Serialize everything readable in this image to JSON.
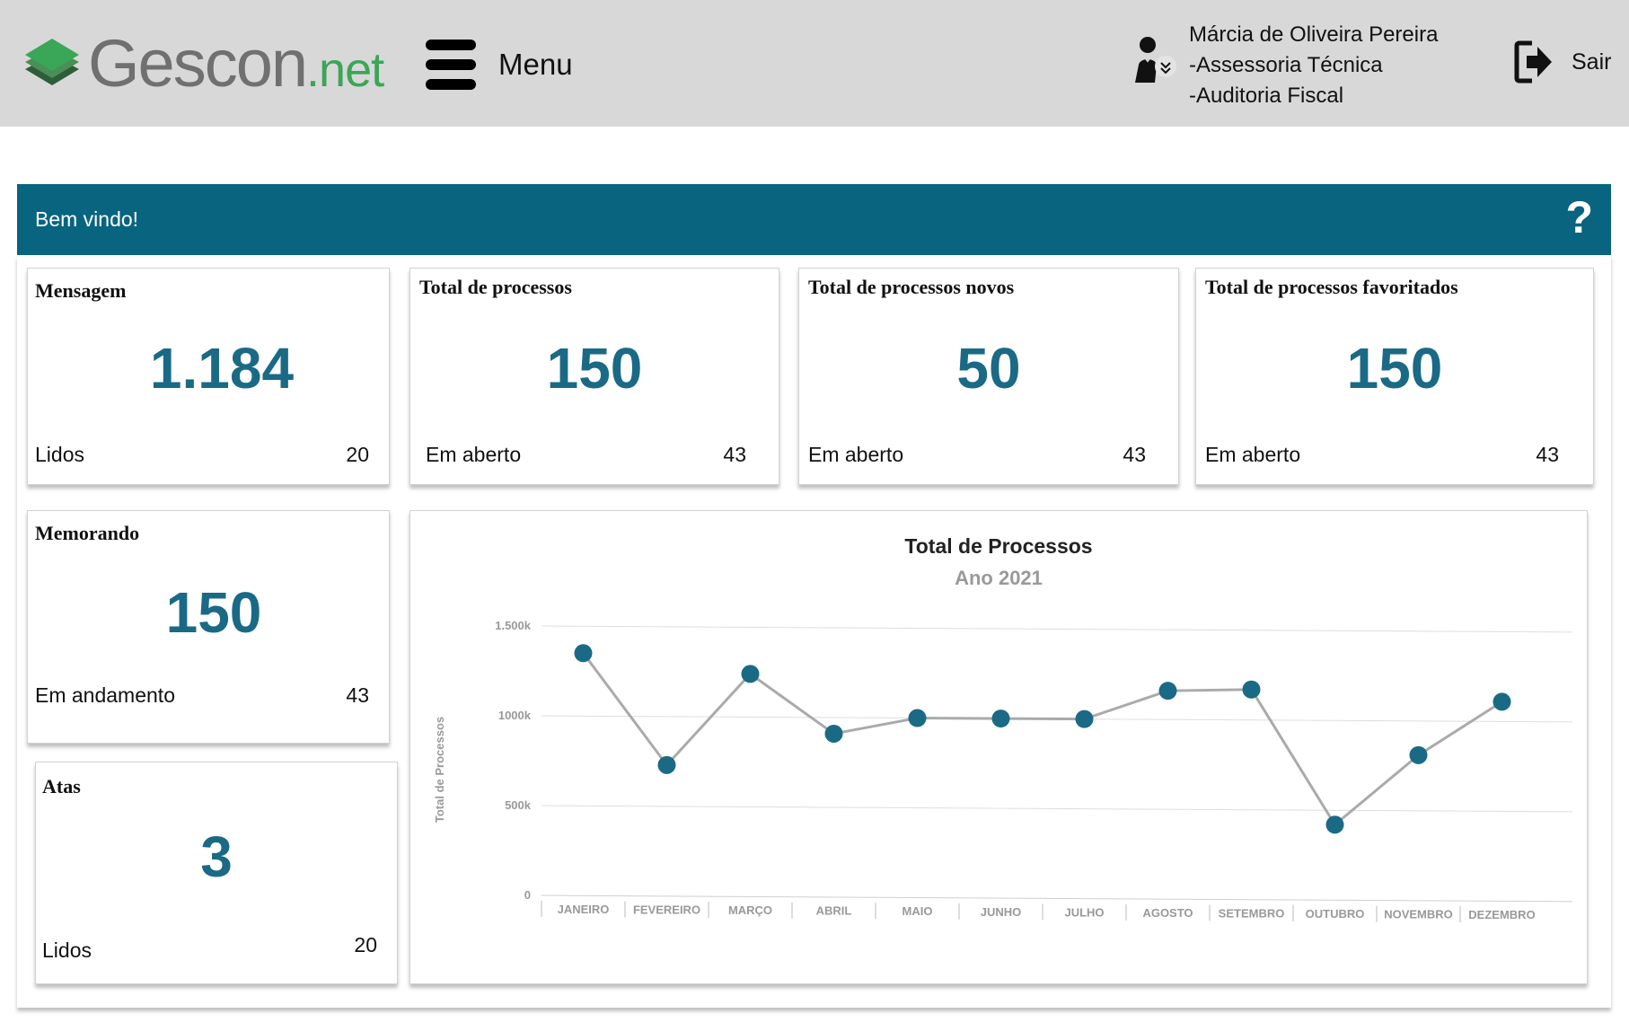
{
  "header": {
    "logo_main": "Gescon",
    "logo_suffix": ".net",
    "menu_label": "Menu",
    "user_lines": [
      "Márcia de Oliveira Pereira",
      "-Assessoria Técnica",
      "-Auditoria Fiscal"
    ],
    "logout_label": "Sair"
  },
  "welcome": {
    "text": "Bem vindo!",
    "help_label": "?"
  },
  "cards": {
    "mensagem": {
      "title": "Mensagem",
      "value": "1.184",
      "foot_label": "Lidos",
      "foot_value": "20"
    },
    "total": {
      "title": "Total de processos",
      "value": "150",
      "foot_label": "Em aberto",
      "foot_value": "43"
    },
    "novos": {
      "title": "Total de processos novos",
      "value": "50",
      "foot_label": "Em aberto",
      "foot_value": "43"
    },
    "favoritados": {
      "title": "Total de processos favoritados",
      "value": "150",
      "foot_label": "Em aberto",
      "foot_value": "43"
    },
    "memorando": {
      "title": "Memorando",
      "value": "150",
      "foot_label": "Em andamento",
      "foot_value": "43"
    },
    "atas": {
      "title": "Atas",
      "value": "3",
      "foot_label": "Lidos",
      "foot_value": "20"
    }
  },
  "colors": {
    "header_bg": "#d8d8d8",
    "accent": "#08647f",
    "value_text": "#1a6a86",
    "logo_green": "#3aa657",
    "line": "#aaaaaa"
  },
  "icons": {
    "logo": "stacked-layers-icon",
    "menu": "hamburger-icon",
    "user": "user-dropdown-icon",
    "logout": "logout-icon",
    "help": "question-icon"
  },
  "chart_data": {
    "type": "line",
    "title": "Total de Processos",
    "subtitle": "Ano 2021",
    "xlabel": "",
    "ylabel": "Total de Processos",
    "categories": [
      "JANEIRO",
      "FEVEREIRO",
      "MARÇO",
      "ABRIL",
      "MAIO",
      "JUNHO",
      "JULHO",
      "AGOSTO",
      "SETEMBRO",
      "OUTUBRO",
      "NOVEMBRO",
      "DEZEMBRO"
    ],
    "values": [
      1350,
      730,
      1240,
      910,
      1000,
      1000,
      1000,
      1160,
      1170,
      420,
      810,
      1110
    ],
    "y_ticks": [
      "0",
      "500k",
      "1000k",
      "1.500k"
    ],
    "y_tick_values": [
      0,
      500,
      1000,
      1500
    ],
    "ylim": [
      0,
      1500
    ],
    "grid": true,
    "legend": "none",
    "color": "#1a6a86"
  }
}
